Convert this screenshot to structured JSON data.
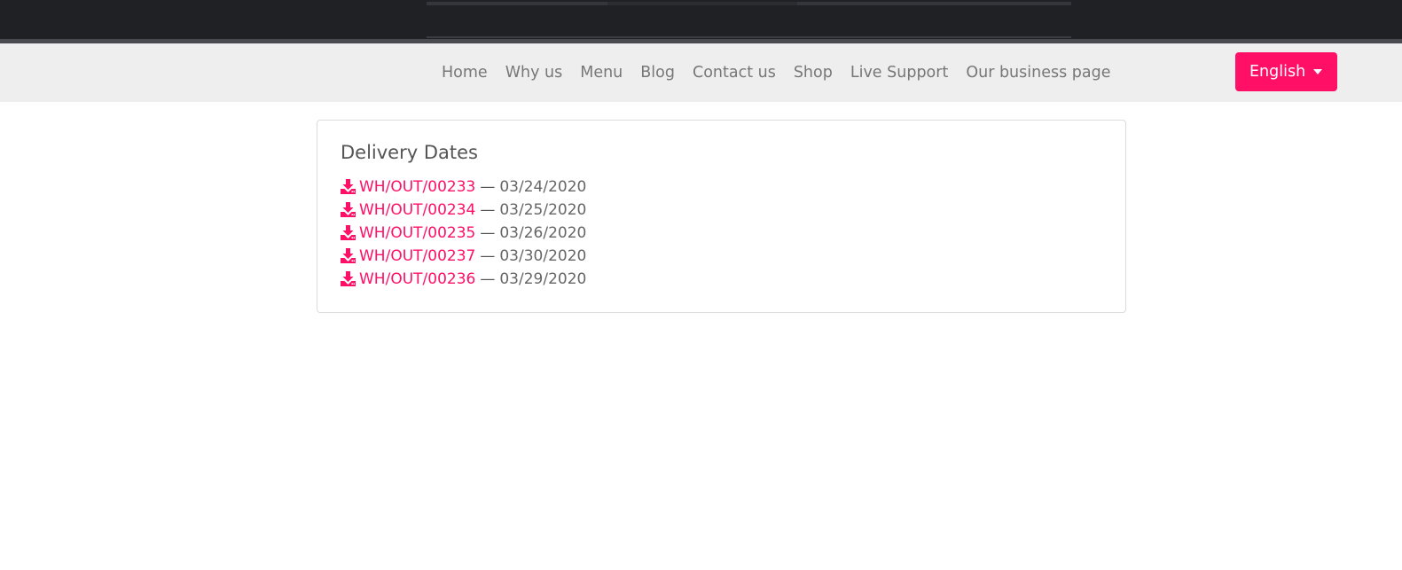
{
  "nav": {
    "links": [
      "Home",
      "Why us",
      "Menu",
      "Blog",
      "Contact us",
      "Shop",
      "Live Support",
      "Our business page"
    ]
  },
  "language": {
    "selected": "English"
  },
  "delivery": {
    "title": "Delivery Dates",
    "separator": "—",
    "items": [
      {
        "ref": "WH/OUT/00233",
        "date": "03/24/2020"
      },
      {
        "ref": "WH/OUT/00234",
        "date": "03/25/2020"
      },
      {
        "ref": "WH/OUT/00235",
        "date": "03/26/2020"
      },
      {
        "ref": "WH/OUT/00237",
        "date": "03/30/2020"
      },
      {
        "ref": "WH/OUT/00236",
        "date": "03/29/2020"
      }
    ]
  },
  "colors": {
    "accent": "#ff0f66",
    "topbar": "#202124",
    "navbar": "#efeeee"
  },
  "icons": {
    "delivery_item": "download-icon",
    "language": "caret-down-icon"
  }
}
